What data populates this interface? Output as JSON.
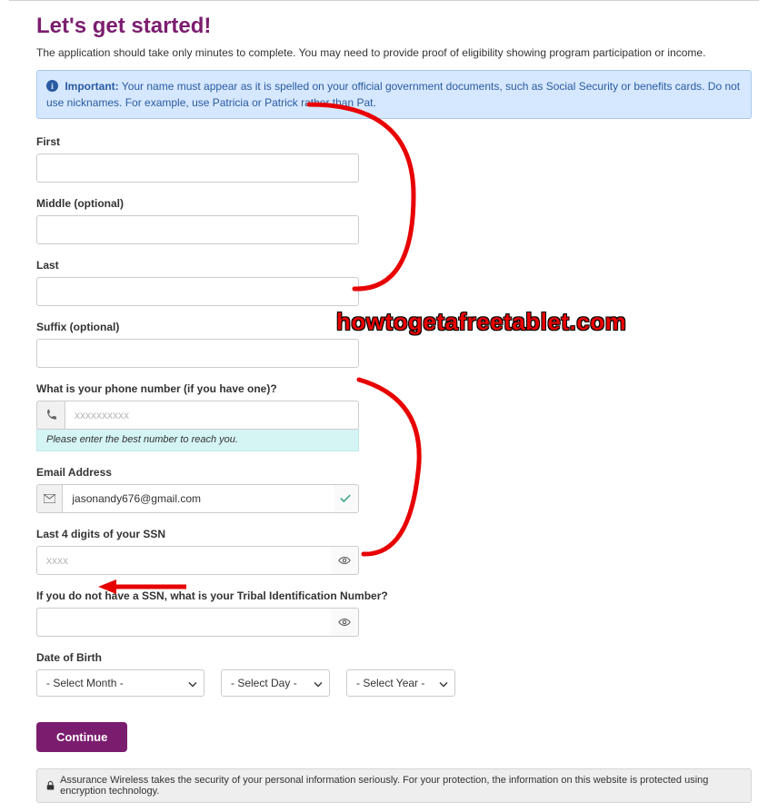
{
  "header": {
    "title": "Let's get started!",
    "intro": "The application should take only minutes to complete. You may need to provide proof of eligibility showing program participation or income."
  },
  "info": {
    "strong": "Important:",
    "text": " Your name must appear as it is spelled on your official government documents, such as Social Security or benefits cards. Do not use nicknames. For example, use Patricia or Patrick rather than Pat."
  },
  "fields": {
    "first": {
      "label": "First",
      "value": ""
    },
    "middle": {
      "label": "Middle (optional)",
      "value": ""
    },
    "last": {
      "label": "Last",
      "value": ""
    },
    "suffix": {
      "label": "Suffix (optional)",
      "value": ""
    },
    "phone": {
      "label": "What is your phone number (if you have one)?",
      "placeholder": "xxxxxxxxxx",
      "value": "",
      "hint": "Please enter the best number to reach you."
    },
    "email": {
      "label": "Email Address",
      "value": "jasonandy676@gmail.com"
    },
    "ssn": {
      "label": "Last 4 digits of your SSN",
      "placeholder": "xxxx",
      "value": ""
    },
    "tribal": {
      "label": "If you do not have a SSN, what is your Tribal Identification Number?",
      "value": ""
    },
    "dob": {
      "label": "Date of Birth",
      "month": "- Select Month -",
      "day": "- Select Day -",
      "year": "- Select Year -"
    }
  },
  "buttons": {
    "continue": "Continue"
  },
  "security": "Assurance Wireless takes the security of your personal information seriously. For your protection, the information on this website is protected using encryption technology.",
  "watermark": "howtogetafreetablet.com"
}
